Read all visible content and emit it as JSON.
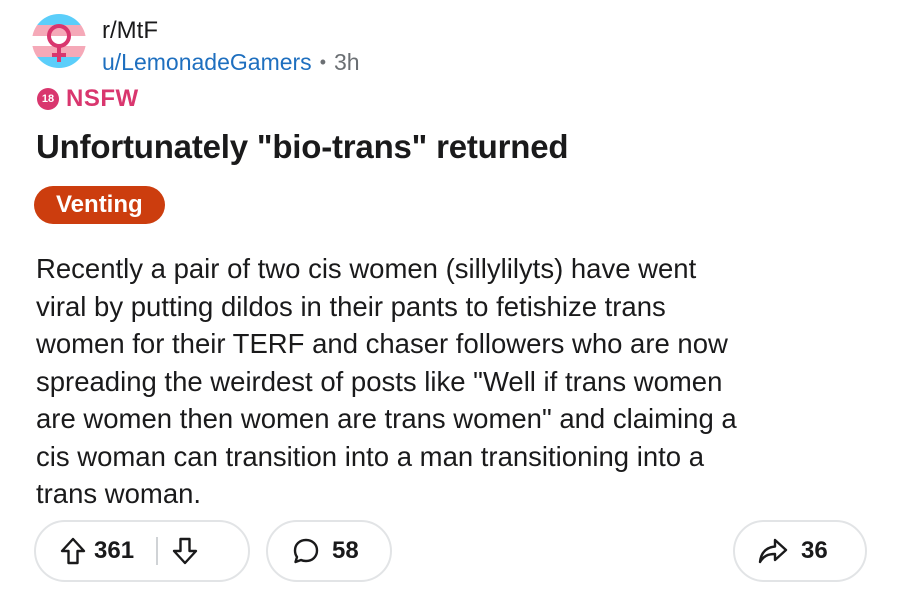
{
  "header": {
    "subreddit": "r/MtF",
    "username": "u/LemonadeGamers",
    "separator": "•",
    "age": "3h",
    "community_icon": "trans-flag-female-symbol-icon"
  },
  "nsfw": {
    "badge_text": "18",
    "label": "NSFW",
    "color": "#d9366e"
  },
  "post": {
    "title": "Unfortunately \"bio-trans\" returned",
    "flair": "Venting",
    "flair_color": "#cc3d0e",
    "body_lines": [
      "Recently a pair of two cis women (sillylilyts) have went",
      "viral by putting dildos in their pants to fetishize trans",
      "women for their TERF and chaser followers who are now",
      "spreading the weirdest of posts like \"Well if trans women",
      "are women then women are trans women\" and claiming a",
      "cis woman can transition into a man transitioning into a",
      "trans woman."
    ]
  },
  "actions": {
    "upvotes": "361",
    "comments": "58",
    "shares": "36",
    "upvote_icon": "arrow-up-icon",
    "downvote_icon": "arrow-down-icon",
    "comment_icon": "comment-bubble-icon",
    "share_icon": "share-arrow-icon"
  },
  "colors": {
    "username": "#1e6fbf",
    "meta": "#6b6f73",
    "trans_blue": "#5bcefa",
    "trans_pink": "#f5a9b8"
  }
}
